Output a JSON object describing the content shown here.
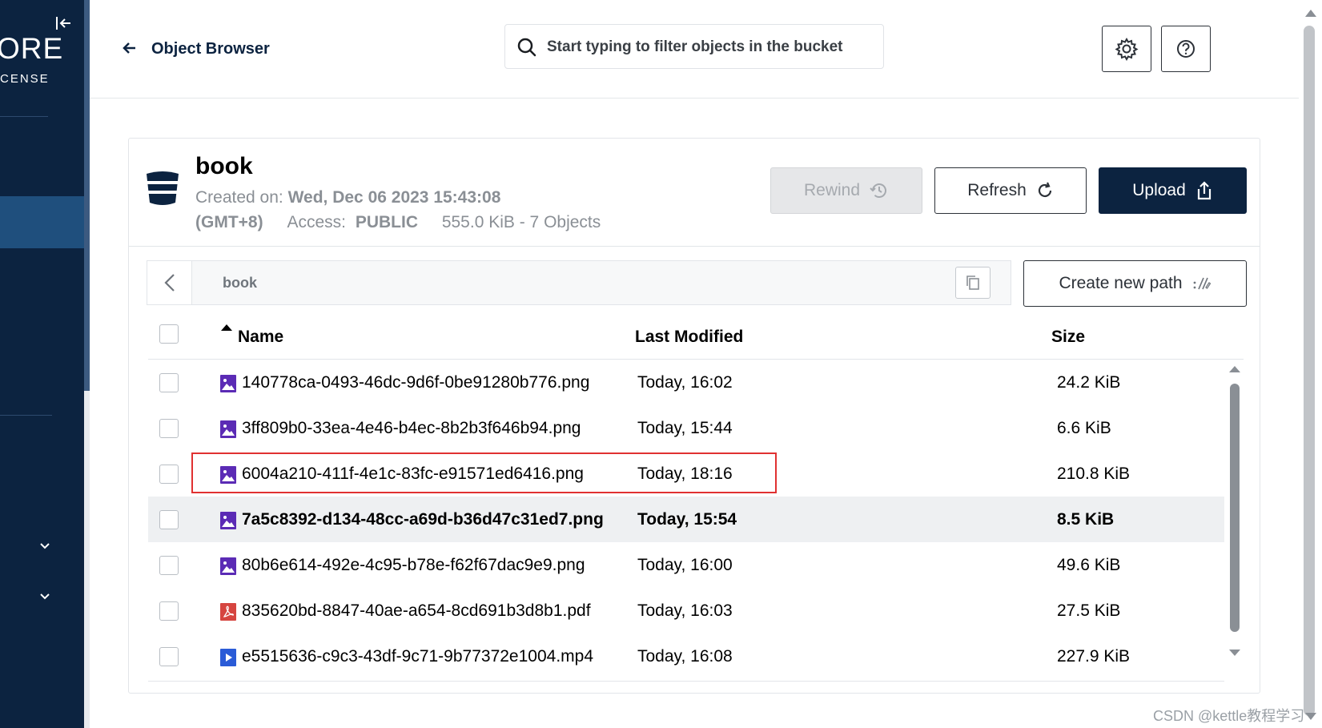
{
  "sidebar": {
    "brand_big": "ORE",
    "brand_small": "CENSE",
    "collapse_icon": "collapse-left-icon"
  },
  "header": {
    "back_icon": "arrow-left-icon",
    "title": "Object Browser",
    "search": {
      "placeholder": "Start typing to filter objects in the bucket",
      "value": ""
    },
    "settings_icon": "gear-icon",
    "help_icon": "question-circle-icon"
  },
  "bucket": {
    "name": "book",
    "created_label": "Created on:",
    "created_value": "Wed, Dec 06 2023 15:43:08",
    "timezone": "(GMT+8)",
    "access_label": "Access:",
    "access_value": "PUBLIC",
    "usage": "555.0 KiB - 7 Objects"
  },
  "actions": {
    "rewind": "Rewind",
    "refresh": "Refresh",
    "upload": "Upload",
    "create_path": "Create new path"
  },
  "path": {
    "current": "book"
  },
  "table": {
    "columns": {
      "name": "Name",
      "modified": "Last Modified",
      "size": "Size"
    },
    "sort": "name-ascending",
    "rows": [
      {
        "name": "140778ca-0493-46dc-9d6f-0be91280b776.png",
        "modified": "Today, 16:02",
        "size": "24.2 KiB",
        "type": "image"
      },
      {
        "name": "3ff809b0-33ea-4e46-b4ec-8b2b3f646b94.png",
        "modified": "Today, 15:44",
        "size": "6.6 KiB",
        "type": "image"
      },
      {
        "name": "6004a210-411f-4e1c-83fc-e91571ed6416.png",
        "modified": "Today, 18:16",
        "size": "210.8 KiB",
        "type": "image"
      },
      {
        "name": "7a5c8392-d134-48cc-a69d-b36d47c31ed7.png",
        "modified": "Today, 15:54",
        "size": "8.5 KiB",
        "type": "image"
      },
      {
        "name": "80b6e614-492e-4c95-b78e-f62f67dac9e9.png",
        "modified": "Today, 16:00",
        "size": "49.6 KiB",
        "type": "image"
      },
      {
        "name": "835620bd-8847-40ae-a654-8cd691b3d8b1.pdf",
        "modified": "Today, 16:03",
        "size": "27.5 KiB",
        "type": "pdf"
      },
      {
        "name": "e5515636-c9c3-43df-9c71-9b77372e1004.mp4",
        "modified": "Today, 16:08",
        "size": "227.9 KiB",
        "type": "video"
      }
    ]
  },
  "colors": {
    "navy": "#0c2340",
    "image_icon": "#5b2bb5",
    "pdf_icon": "#d64540",
    "video_icon": "#2a5bd7",
    "highlight": "#e03131"
  },
  "watermark": "CSDN @kettle教程学习"
}
